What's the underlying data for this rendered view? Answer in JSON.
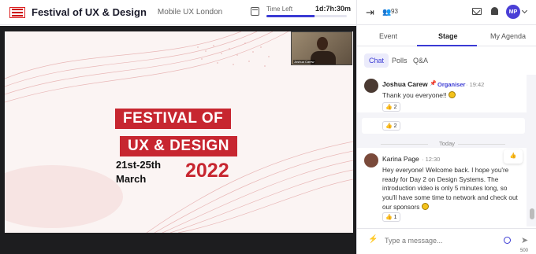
{
  "header": {
    "title": "Festival of UX & Design",
    "organizer": "Mobile UX London",
    "calendar_icon": "calendar-icon",
    "time_left_label": "Time Left",
    "time_left_value": "1d:7h:30m",
    "time_left_fraction": 0.6
  },
  "slide": {
    "line1": "FESTIVAL OF",
    "line2": "UX & DESIGN",
    "dates_line1": "21st-25th",
    "dates_line2": "March",
    "year": "2022",
    "speaker_tag": "Joshua Carew",
    "accent": "#c72630"
  },
  "right_header": {
    "collapse_icon": "expand-right-icon",
    "people_count": "93",
    "avatar_initials": "MP",
    "avatar_color": "#4a3fd6"
  },
  "tabs": [
    "Event",
    "Stage",
    "My Agenda"
  ],
  "subtabs": [
    "Chat",
    "Polls",
    "Q&A"
  ],
  "messages": [
    {
      "author": "Joshua Carew",
      "badge": "Organiser",
      "time": "· 19:42",
      "text": "Thank you everyone!!",
      "reaction_count": "2"
    },
    {
      "reaction_count": "2"
    },
    {
      "author": "Karina Page",
      "time": "· 12:30",
      "text": "Hey everyone! Welcome back. I hope you're ready for Day 2 on Design Systems. The introduction video is only 5 minutes long, so you'll have some time to network and check out our sponsors",
      "reaction_count": "1"
    }
  ],
  "separator": "Today",
  "input": {
    "placeholder": "Type a message...",
    "char_limit": "500"
  },
  "accent_color": "#3b3bd4"
}
